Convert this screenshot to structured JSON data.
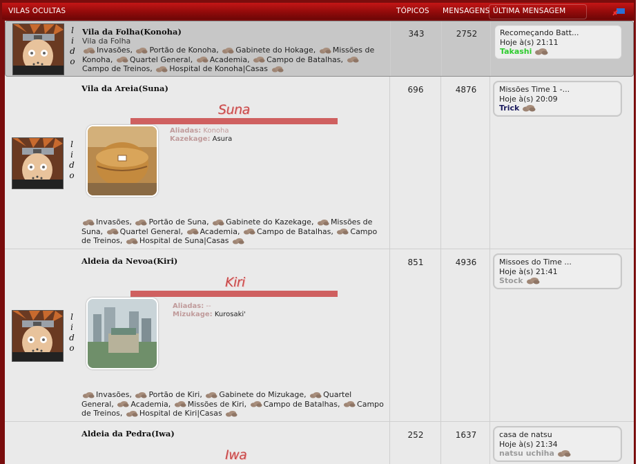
{
  "header": {
    "title": "VILAS OCULTAS",
    "col_topics": "TÓPICOS",
    "col_messages": "MENSAGENS",
    "col_last": "ÚLTIMA MENSAGEM"
  },
  "status_label": "l i d o",
  "forums": [
    {
      "name": "Vila da Folha(Konoha)",
      "description": "Vila da Folha",
      "subforums": [
        "Invasões",
        "Portão de Konoha",
        "Gabinete do Hokage",
        "Missões de Konoha",
        "Quartel General",
        "Academia",
        "Campo de Batalhas",
        "Campo de Treinos",
        "Hospital de Konoha|Casas"
      ],
      "topics": "343",
      "messages": "2752",
      "last": {
        "title": "Recomeçando Batt...",
        "date": "Hoje à(s) 21:11",
        "user": "Takashi",
        "user_color": "#2ecb2e"
      }
    },
    {
      "name": "Vila da Areia(Suna)",
      "banner": "Suna",
      "info_label_1": "Aliadas:",
      "info_value_1": "Konoha",
      "info_label_2": "Kazekage:",
      "info_value_2": "Asura",
      "subforums": [
        "Invasões",
        "Portão de Suna",
        "Gabinete do Kazekage",
        "Missões de Suna",
        "Quartel General",
        "Academia",
        "Campo de Batalhas",
        "Campo de Treinos",
        "Hospital de Suna|Casas"
      ],
      "topics": "696",
      "messages": "4876",
      "last": {
        "title": "Missões Time 1 -...",
        "date": "Hoje à(s) 20:09",
        "user": "Trick",
        "user_color": "#1a1a5e"
      }
    },
    {
      "name": "Aldeia da Nevoa(Kiri)",
      "banner": "Kiri",
      "info_label_1": "Aliadas:",
      "info_value_1": "--",
      "info_label_2": "Mizukage:",
      "info_value_2": "Kurosaki'",
      "subforums": [
        "Invasões",
        "Portão de Kiri",
        "Gabinete do Mizukage",
        "Quartel General",
        "Academia",
        "Missões de Kiri",
        "Campo de Batalhas",
        "Campo de Treinos",
        "Hospital de Kiri|Casas"
      ],
      "topics": "851",
      "messages": "4936",
      "last": {
        "title": "Missoes do Time ...",
        "date": "Hoje à(s) 21:41",
        "user": "Stock",
        "user_color": "#9a9a9a"
      }
    },
    {
      "name": "Aldeia da Pedra(Iwa)",
      "banner": "Iwa",
      "topics": "252",
      "messages": "1637",
      "last": {
        "title": "casa de natsu",
        "date": "Hoje à(s) 21:34",
        "user": "natsu uchiha",
        "user_color": "#9a9a9a"
      }
    }
  ],
  "colors": {
    "header": "#b01010",
    "frame": "#7a0d0d",
    "banner": "#cf6060",
    "row_bg": "#eaeaea"
  },
  "icons": [
    "cloud-icon",
    "avatar-image",
    "village-image",
    "rss-icon"
  ]
}
